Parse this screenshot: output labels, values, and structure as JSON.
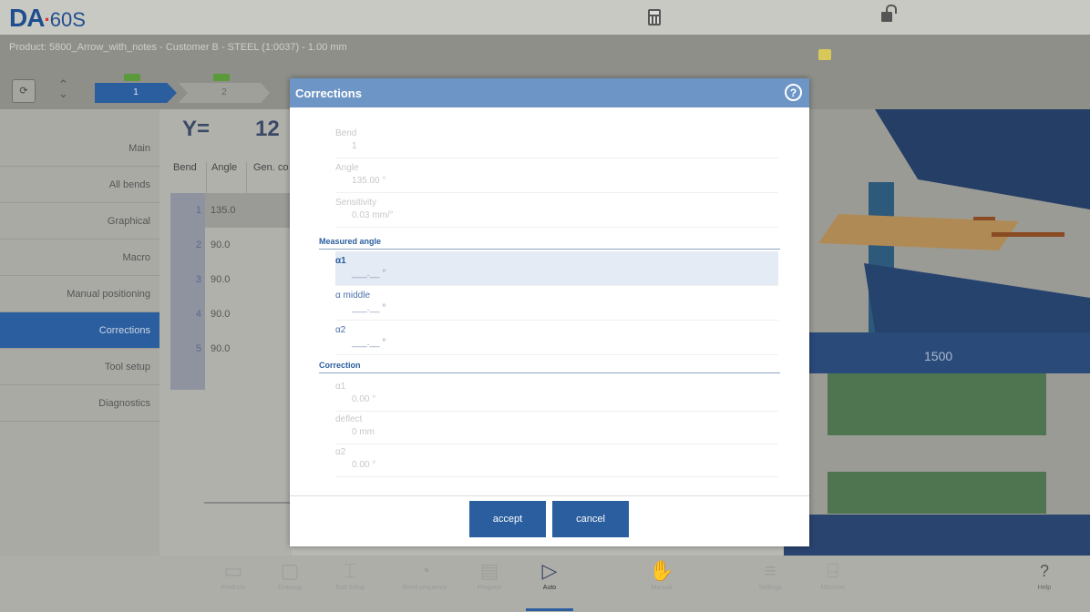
{
  "header": {
    "logo_brand": "DA",
    "logo_dot": "·",
    "logo_model": "60S",
    "icons": [
      "calculator-icon",
      "unlock-icon"
    ]
  },
  "product_bar": {
    "text": "Product: 5800_Arrow_with_notes - Customer B - STEEL (1:0037) - 1.00 mm",
    "icon": "note-icon"
  },
  "steps": {
    "items": [
      {
        "label": "1",
        "active": true
      },
      {
        "label": "2",
        "active": false
      }
    ]
  },
  "sidebar": {
    "items": [
      {
        "label": "Main"
      },
      {
        "label": "All bends"
      },
      {
        "label": "Graphical"
      },
      {
        "label": "Macro"
      },
      {
        "label": "Manual positioning"
      },
      {
        "label": "Corrections",
        "active": true
      },
      {
        "label": "Tool setup"
      },
      {
        "label": "Diagnostics"
      }
    ]
  },
  "main": {
    "y_label": "Y=",
    "y_value": "12",
    "columns": [
      "Bend",
      "Angle",
      "Gen. co"
    ],
    "rows": [
      {
        "bend": "1",
        "angle": "135.0"
      },
      {
        "bend": "2",
        "angle": "90.0"
      },
      {
        "bend": "3",
        "angle": "90.0"
      },
      {
        "bend": "4",
        "angle": "90.0"
      },
      {
        "bend": "5",
        "angle": "90.0"
      }
    ]
  },
  "view3d": {
    "band_value": "1500"
  },
  "dialog": {
    "title": "Corrections",
    "info": [
      {
        "label": "Bend",
        "value": "1"
      },
      {
        "label": "Angle",
        "value": "135.00 °"
      },
      {
        "label": "Sensitivity",
        "value": "0.03 mm/°"
      }
    ],
    "measured_section": "Measured angle",
    "measured": [
      {
        "label": "α1",
        "value": "___.__ °"
      },
      {
        "label": "α middle",
        "value": "___.__ °"
      },
      {
        "label": "α2",
        "value": "___.__ °"
      }
    ],
    "correction_section": "Correction",
    "correction": [
      {
        "label": "α1",
        "value": "0.00 °"
      },
      {
        "label": "deflect",
        "value": "0 mm"
      },
      {
        "label": "α2",
        "value": "0.00 °"
      }
    ],
    "accept_label": "accept",
    "cancel_label": "cancel"
  },
  "toolbar": {
    "items": [
      {
        "label": "Products",
        "icon": "folder-icon"
      },
      {
        "label": "Drawing",
        "icon": "drawing-icon"
      },
      {
        "label": "Tool Setup",
        "icon": "tool-setup-icon"
      },
      {
        "label": "Bend sequence",
        "icon": "bend-sequence-icon"
      },
      {
        "label": "Program",
        "icon": "program-icon"
      },
      {
        "label": "Auto",
        "icon": "play-icon"
      },
      {
        "label": "Manual",
        "icon": "hand-icon"
      },
      {
        "label": "Settings",
        "icon": "settings-icon"
      },
      {
        "label": "Machine",
        "icon": "machine-icon"
      },
      {
        "label": "Help",
        "icon": "help-icon"
      }
    ]
  }
}
